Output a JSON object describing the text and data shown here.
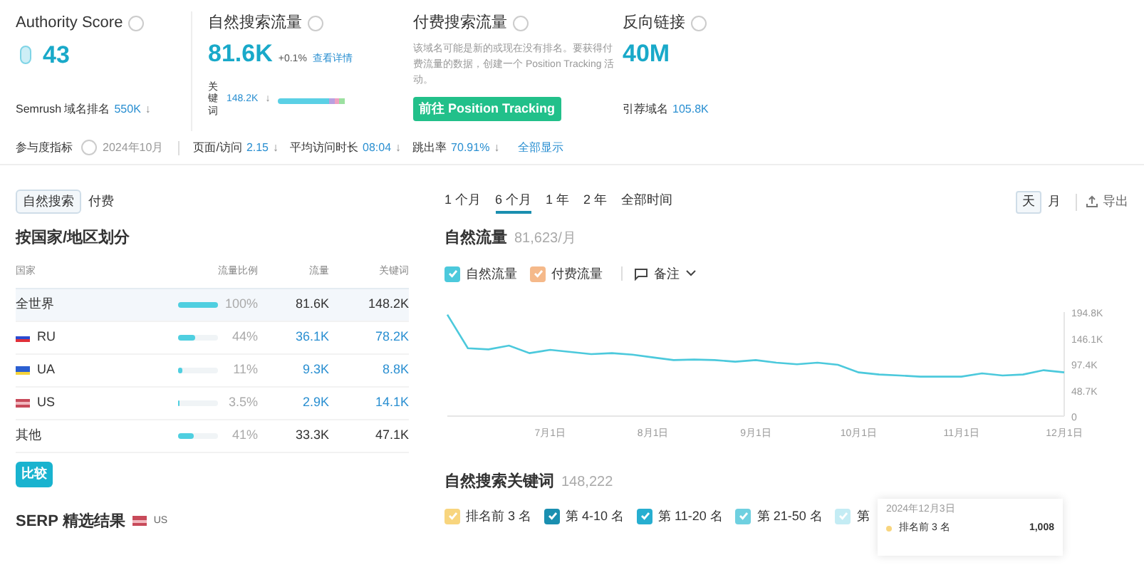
{
  "summary": {
    "authority": {
      "label": "Authority Score",
      "value": "43",
      "rank_label": "Semrush 域名排名",
      "rank_value": "550K",
      "rank_arrow": "↓"
    },
    "organic": {
      "label": "自然搜索流量",
      "value": "81.6K",
      "change": "+0.1%",
      "link": "查看详情",
      "kw_label": "关键词",
      "kw_value": "148.2K",
      "kw_arrow": "↓"
    },
    "paid": {
      "label": "付费搜索流量",
      "note": "该域名可能是新的或现在没有排名。要获得付费流量的数据，创建一个 Position Tracking 活动。",
      "button": "前往 Position Tracking"
    },
    "backlinks": {
      "label": "反向链接",
      "value": "40M",
      "ref_label": "引荐域名",
      "ref_value": "105.8K"
    }
  },
  "engagement": {
    "label": "参与度指标",
    "date": "2024年10月",
    "metrics": [
      {
        "label": "页面/访问",
        "value": "2.15",
        "arrow": "↓"
      },
      {
        "label": "平均访问时长",
        "value": "08:04",
        "arrow": "↓"
      },
      {
        "label": "跳出率",
        "value": "70.91%",
        "arrow": "↓"
      }
    ],
    "show_all": "全部显示"
  },
  "source_tabs": [
    {
      "label": "自然搜索",
      "selected": true
    },
    {
      "label": "付费",
      "selected": false
    }
  ],
  "country_table": {
    "title": "按国家/地区划分",
    "columns": [
      "国家",
      "流量比例",
      "流量",
      "关键词"
    ],
    "rows": [
      {
        "name": "全世界",
        "level": 1,
        "share": "100%",
        "traffic": "81.6K",
        "keywords": "148.2K",
        "kind": "total",
        "selected": true
      },
      {
        "name": "RU",
        "flag": {
          "kind": "ru"
        },
        "level": 0.44,
        "share": "44%",
        "traffic": "36.1K",
        "keywords": "78.2K",
        "kind": "country",
        "selected": false
      },
      {
        "name": "UA",
        "flag": {
          "kind": "ua"
        },
        "level": 0.11,
        "share": "11%",
        "traffic": "9.3K",
        "keywords": "8.8K",
        "kind": "country",
        "selected": false
      },
      {
        "name": "US",
        "flag": {
          "kind": "us"
        },
        "level": 0.035,
        "share": "3.5%",
        "traffic": "2.9K",
        "keywords": "14.1K",
        "kind": "country",
        "selected": false
      },
      {
        "name": "其他",
        "level": 0.41,
        "share": "41%",
        "traffic": "33.3K",
        "keywords": "47.1K",
        "kind": "total",
        "selected": false
      }
    ],
    "compare_button": "比较"
  },
  "serp": {
    "title": "SERP 精选结果",
    "flag": {
      "kind": "us"
    },
    "country": "US"
  },
  "range_tabs": [
    {
      "label": "1 个月",
      "selected": false
    },
    {
      "label": "6 个月",
      "selected": true
    },
    {
      "label": "1 年",
      "selected": false
    },
    {
      "label": "2 年",
      "selected": false
    },
    {
      "label": "全部时间",
      "selected": false
    }
  ],
  "granularity": [
    {
      "label": "天",
      "selected": true
    },
    {
      "label": "月",
      "selected": false
    }
  ],
  "export_button": "导出",
  "traffic_chart": {
    "title": "自然流量",
    "subtitle": "81,623/月",
    "legend": [
      {
        "label": "自然流量",
        "checked": true,
        "color": "#4cc9dc"
      },
      {
        "label": "付费流量",
        "checked": true,
        "color": "#f5b98a"
      }
    ],
    "notes": "备注",
    "chart_data": {
      "type": "line",
      "categories": [
        null,
        null,
        null,
        null,
        null,
        "7月1日",
        null,
        null,
        null,
        null,
        "8月1日",
        null,
        null,
        null,
        null,
        "9月1日",
        null,
        null,
        null,
        null,
        "10月1日",
        null,
        null,
        null,
        null,
        "11月1日",
        null,
        null,
        null,
        null,
        "12月1日"
      ],
      "series": [
        {
          "color": "#4cc9dc",
          "values": [
            190,
            127,
            125,
            132,
            118,
            124,
            120,
            116,
            118,
            115,
            110,
            105,
            106,
            105,
            102,
            105,
            100,
            97,
            100,
            96,
            82,
            78,
            76,
            74,
            74,
            74,
            80,
            76,
            78,
            86,
            82
          ]
        }
      ],
      "ylim": [
        0,
        194.8
      ],
      "yticks": [
        {
          "value": 0,
          "label": "0"
        },
        {
          "value": 48.7,
          "label": "48.7K"
        },
        {
          "value": 97.4,
          "label": "97.4K"
        },
        {
          "value": 146.1,
          "label": "146.1K"
        },
        {
          "value": 194.8,
          "label": "194.8K"
        }
      ]
    }
  },
  "keywords": {
    "title": "自然搜索关键词",
    "count": "148,222",
    "legend": [
      {
        "label": "排名前 3 名",
        "checked": true,
        "color": "#f8d57e"
      },
      {
        "label": "第 4-10 名",
        "checked": true,
        "color": "#1a8fb0"
      },
      {
        "label": "第 11-20 名",
        "checked": true,
        "color": "#27aed0"
      },
      {
        "label": "第 21-50 名",
        "checked": true,
        "color": "#6fd0e0"
      },
      {
        "label": "第",
        "checked": true,
        "color": "#c4ecf4"
      }
    ],
    "tooltip": {
      "date": "2024年12月3日",
      "rows": [
        {
          "label": "排名前 3 名",
          "value": "1,008",
          "color": "#f8d57e"
        }
      ]
    }
  }
}
